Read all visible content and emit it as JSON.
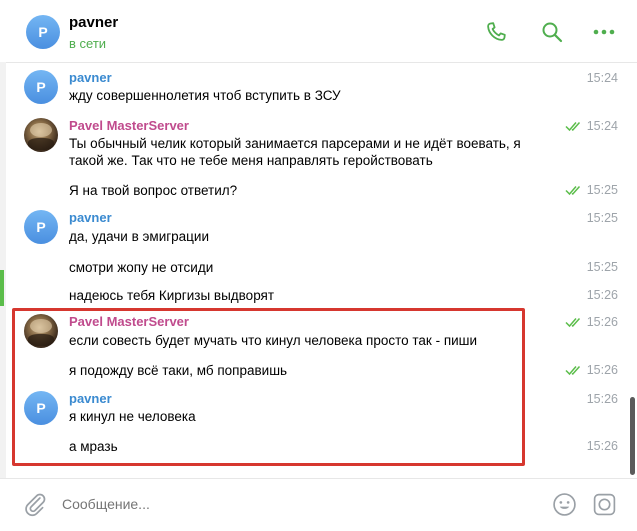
{
  "header": {
    "avatar_letter": "P",
    "name": "pavner",
    "status": "в сети",
    "icons": [
      "phone-icon",
      "search-icon",
      "more-icon"
    ]
  },
  "messages": [
    {
      "author": "pavner",
      "avatar": "P",
      "text": "жду совершеннолетия чтоб вступить в ЗСУ",
      "time": "15:24",
      "read": false
    },
    {
      "author": "Pavel MasterServer",
      "avatar": "photo",
      "text": "Ты обычный челик который занимается парсерами и не идёт воевать, я такой же. Так что не тебе меня направлять геройствовать",
      "time": "15:24",
      "read": true
    },
    {
      "author": null,
      "text": "Я на твой вопрос ответил?",
      "time": "15:25",
      "read": true
    },
    {
      "author": "pavner",
      "avatar": "P",
      "text": "да, удачи в эмиграции",
      "time": "15:25",
      "read": false
    },
    {
      "author": null,
      "text": "смотри жопу не отсиди",
      "time": "15:25",
      "read": false
    },
    {
      "author": null,
      "text": "надеюсь тебя Киргизы выдворят",
      "time": "15:26",
      "read": false
    },
    {
      "author": "Pavel MasterServer",
      "avatar": "photo",
      "text": "если совесть будет мучать что кинул человека просто так - пиши",
      "time": "15:26",
      "read": true
    },
    {
      "author": null,
      "text": "я подожду всё таки, мб поправишь",
      "time": "15:26",
      "read": true
    },
    {
      "author": "pavner",
      "avatar": "P",
      "text": "я кинул не человека",
      "time": "15:26",
      "read": false
    },
    {
      "author": null,
      "text": "а мразь",
      "time": "15:26",
      "read": false
    }
  ],
  "composer": {
    "placeholder": "Сообщение...",
    "icons": [
      "attach-icon",
      "emoji-icon",
      "sticker-icon"
    ]
  },
  "colors": {
    "accent_green": "#4fae4e",
    "name_blue": "#3a8ad0",
    "name_pink": "#c04b8d",
    "highlight_red": "#d6372f"
  }
}
